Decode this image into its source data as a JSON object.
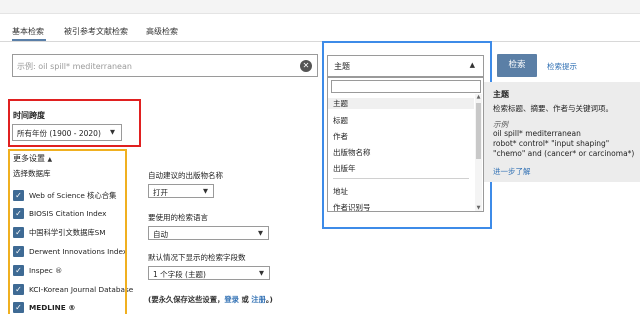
{
  "tabs": {
    "basic": "基本检索",
    "cited_ref": "被引参考文献检索",
    "advanced": "高级检索"
  },
  "search": {
    "placeholder": "示例: oil spill* mediterranean",
    "value": "",
    "clear_icon": "close-circle-icon",
    "button_label": "检索",
    "tips_label": "检索提示"
  },
  "field_select": {
    "selected": "主题",
    "options": [
      "主题",
      "标题",
      "作者",
      "出版物名称",
      "出版年",
      "地址",
      "作者识别号"
    ]
  },
  "help": {
    "title": "主题",
    "desc": "检索标题、摘要、作者与关键词项。",
    "example_label": "示例",
    "examples": [
      "oil spill* mediterranean",
      "robot* control* \"input shaping\"",
      "\"chemo\" and (cancer* or carcinoma*)"
    ],
    "learn_more": "进一步了解"
  },
  "timespan": {
    "label": "时间跨度",
    "value": "所有年份 (1900 - 2020)"
  },
  "more_settings": {
    "label": "更多设置",
    "db_title": "选择数据库",
    "databases": [
      "Web of Science 核心合集",
      "BIOSIS Citation Index",
      "中国科学引文数据库SM",
      "Derwent Innovations Index",
      "Inspec ®",
      "KCI-Korean Journal Database",
      "MEDLINE ®"
    ]
  },
  "options": {
    "autosuggest_label": "自动建议的出版物名称",
    "autosuggest_value": "打开",
    "language_label": "要使用的检索语言",
    "language_value": "自动",
    "fields_label": "默认情况下显示的检索字段数",
    "fields_value": "1 个字段 (主题)",
    "save_prefix": "(要永久保存这些设置，",
    "login": "登录",
    "or": " 或 ",
    "register": "注册",
    "save_suffix": "。)"
  },
  "colors": {
    "highlight_red": "#e02020",
    "highlight_orange": "#f0b020",
    "highlight_blue": "#3d8be8",
    "primary_button": "#5b7fa6",
    "link": "#2f6fb3"
  }
}
